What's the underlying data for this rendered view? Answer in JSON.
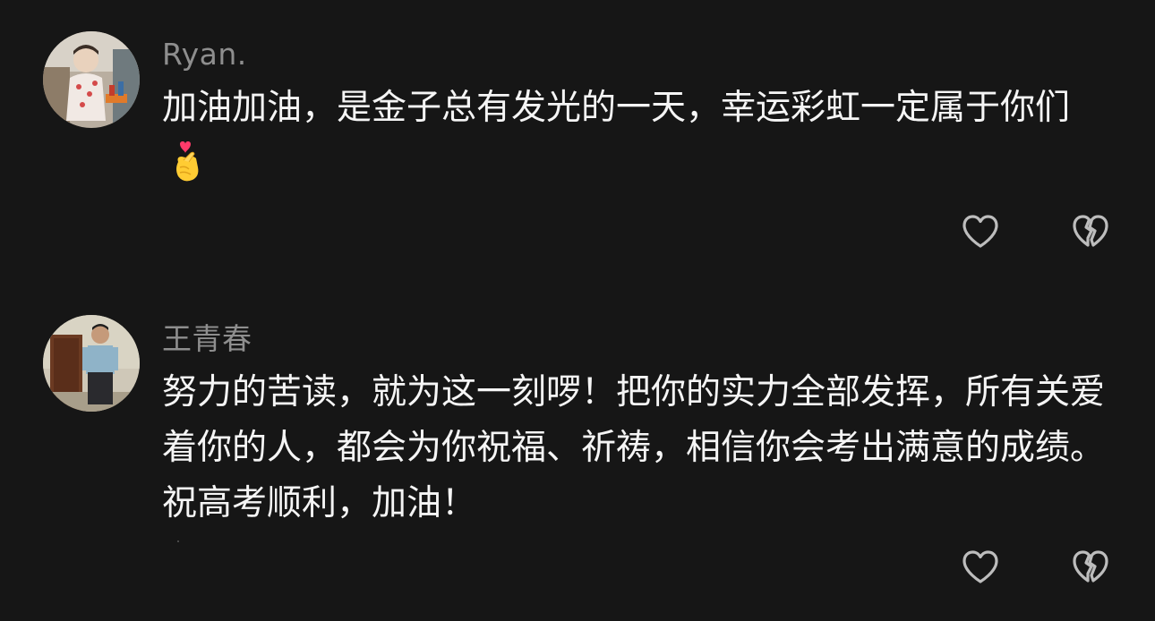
{
  "comments": [
    {
      "username": "Ryan.",
      "text": "加油加油，是金子总有发光的一天，幸运彩虹一定属于你们",
      "emoji": "finger-heart-emoji"
    },
    {
      "username": "王青春",
      "text": "努力的苦读，就为这一刻啰！把你的实力全部发挥，所有关爱着你的人，都会为你祝福、祈祷，相信你会考出满意的成绩。祝高考顺利，加油！"
    }
  ],
  "icons": {
    "like": "heart-outline-icon",
    "dislike": "broken-heart-outline-icon"
  },
  "colors": {
    "background": "#161616",
    "username": "#8e8e8e",
    "text": "#f5f5f5",
    "icon": "#bdbdbd"
  }
}
